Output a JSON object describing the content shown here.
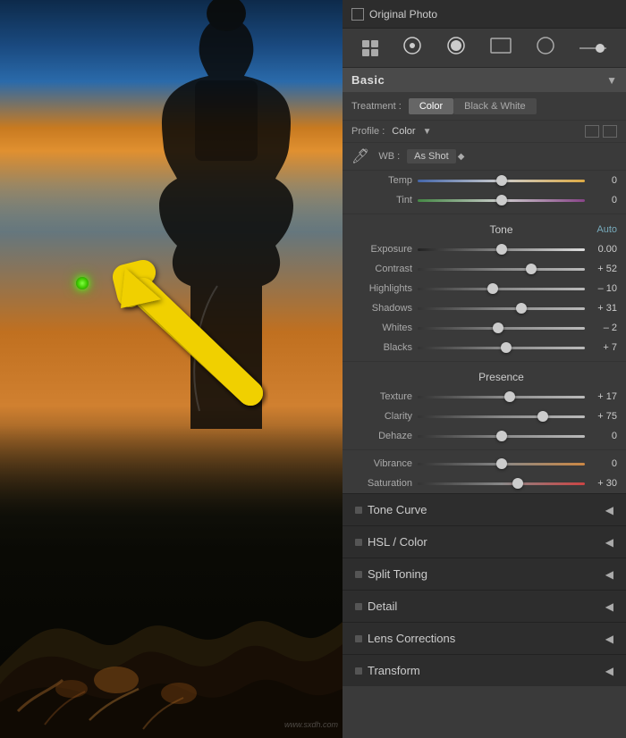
{
  "topbar": {
    "original_photo_label": "Original Photo",
    "checkbox_state": false
  },
  "toolbar": {
    "icons": [
      "grid",
      "circle-dot",
      "circle-filled",
      "rect",
      "circle-empty",
      "slider"
    ]
  },
  "basic_panel": {
    "title": "Basic",
    "treatment_label": "Treatment :",
    "treatment_color": "Color",
    "treatment_bw": "Black & White",
    "profile_label": "Profile :",
    "profile_value": "Color",
    "wb_label": "WB :",
    "wb_value": "As Shot",
    "tone_label": "Tone",
    "tone_auto": "Auto",
    "sliders": {
      "temp": {
        "name": "Temp",
        "value": "0",
        "position": 50
      },
      "tint": {
        "name": "Tint",
        "value": "0",
        "position": 50
      },
      "exposure": {
        "name": "Exposure",
        "value": "0.00",
        "position": 50
      },
      "contrast": {
        "name": "Contrast",
        "value": "+ 52",
        "position": 68
      },
      "highlights": {
        "name": "Highlights",
        "value": "– 10",
        "position": 45
      },
      "shadows": {
        "name": "Shadows",
        "value": "+ 31",
        "position": 62
      },
      "whites": {
        "name": "Whites",
        "value": "– 2",
        "position": 48
      },
      "blacks": {
        "name": "Blacks",
        "value": "+ 7",
        "position": 53
      }
    },
    "presence_label": "Presence",
    "presence_sliders": {
      "texture": {
        "name": "Texture",
        "value": "+ 17",
        "position": 55
      },
      "clarity": {
        "name": "Clarity",
        "value": "+ 75",
        "position": 75
      },
      "dehaze": {
        "name": "Dehaze",
        "value": "0",
        "position": 50
      },
      "vibrance": {
        "name": "Vibrance",
        "value": "0",
        "position": 50
      },
      "saturation": {
        "name": "Saturation",
        "value": "+ 30",
        "position": 60
      }
    }
  },
  "collapsed_sections": [
    {
      "label": "Tone Curve"
    },
    {
      "label": "HSL / Color"
    },
    {
      "label": "Split Toning"
    },
    {
      "label": "Detail"
    },
    {
      "label": "Lens Corrections"
    },
    {
      "label": "Transform"
    }
  ],
  "photo": {
    "watermark": "www.sxdh.com"
  }
}
